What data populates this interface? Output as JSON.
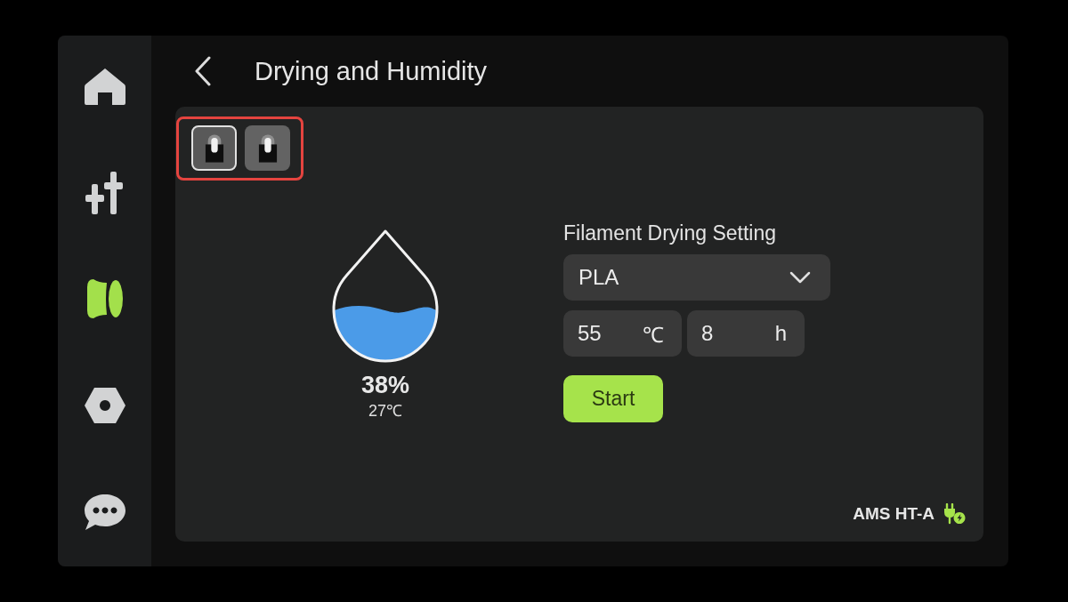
{
  "nav": [
    {
      "kind": "home",
      "selected": false
    },
    {
      "kind": "controls",
      "selected": false
    },
    {
      "kind": "filament",
      "selected": true
    },
    {
      "kind": "parts",
      "selected": false
    },
    {
      "kind": "messages",
      "selected": false
    }
  ],
  "header": {
    "title": "Drying and Humidity"
  },
  "unit_picker": {
    "highlighted": true,
    "units": [
      {
        "selected": true
      },
      {
        "selected": false
      }
    ]
  },
  "humidity": {
    "level": 0.38,
    "reading": "38%",
    "temperature": "27℃"
  },
  "drying": {
    "label": "Filament Drying Setting",
    "material": "PLA",
    "temperature": {
      "value": "55",
      "unit": "℃"
    },
    "duration": {
      "value": "8",
      "unit": "h"
    },
    "button": "Start"
  },
  "device": {
    "name": "AMS HT-A"
  }
}
